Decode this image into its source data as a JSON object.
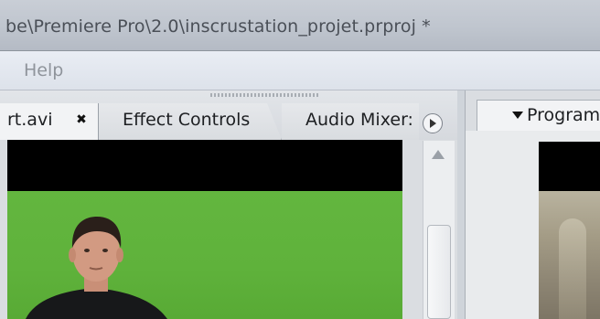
{
  "window": {
    "title": "be\\Premiere Pro\\2.0\\inscrustation_projet.prproj *"
  },
  "menubar": {
    "items": [
      "Help"
    ]
  },
  "source_panel": {
    "tabs": [
      {
        "label": "rt.avi",
        "active": true,
        "close_glyph": "✖"
      },
      {
        "label": "Effect Controls",
        "active": false
      },
      {
        "label": "Audio Mixer:",
        "active": false
      }
    ],
    "menu_icon": "panel-menu-icon"
  },
  "program_panel": {
    "tab_label": "Program"
  },
  "colors": {
    "green_screen": "#5fb23b",
    "title_text": "#4a4f57",
    "menu_text_disabled": "#8f949b"
  }
}
